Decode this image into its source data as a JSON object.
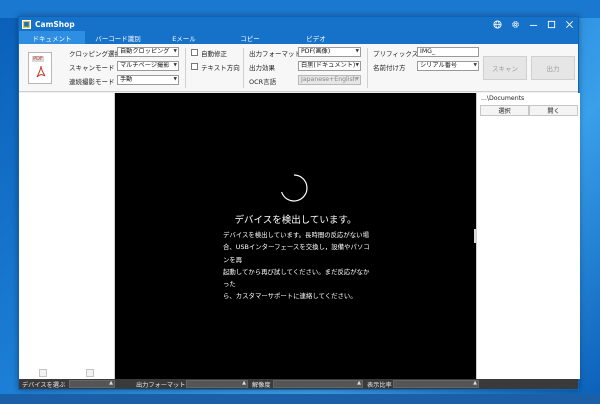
{
  "app": {
    "title": "CamShop"
  },
  "titlebar": {
    "icons": [
      "globe-icon",
      "gear-icon",
      "minimize-icon",
      "maximize-icon",
      "close-icon"
    ]
  },
  "tabs": [
    {
      "label": "ドキュメント",
      "active": true
    },
    {
      "label": "バーコード識別",
      "active": false
    },
    {
      "label": "Eメール",
      "active": false
    },
    {
      "label": "コピー",
      "active": false
    },
    {
      "label": "ビデオ",
      "active": false
    }
  ],
  "toolbar": {
    "pdf_tag": "PDF",
    "crop_label": "クロッピング選択",
    "crop_value": "自動クロッピング",
    "scan_mode_label": "スキャンモード",
    "scan_mode_value": "マルチページ撮影",
    "burst_label": "連続撮影モード",
    "burst_value": "手動",
    "auto_correct_label": "自動修正",
    "text_direction_label": "テキスト方向",
    "output_format_label": "出力フォーマット",
    "output_format_value": "PDF(画像)",
    "output_effect_label": "出力効果",
    "output_effect_value": "白黒(ドキュメント)",
    "ocr_label": "OCR言語",
    "ocr_value": "Japanese+English",
    "prefix_label": "プリフィックス",
    "prefix_value": "IMG_",
    "naming_label": "名前付け方",
    "naming_value": "シリアル番号",
    "scan_button": "スキャン",
    "output_button": "出力"
  },
  "preview": {
    "title": "デバイスを検出しています。",
    "body_lines": [
      "デバイスを検出しています。長時間の反応がない場",
      "合、USBインターフェースを交換し，設備やパソコンを再",
      "起動してから再び試してください。まだ反応がなかった",
      "ら、カスタマーサポートに連絡してください。"
    ]
  },
  "right_panel": {
    "path": "...\\Documents",
    "select_button": "選択",
    "open_button": "開く"
  },
  "bottombar": {
    "device_label": "デバイスを選ぶ",
    "output_format_label": "出力フォーマット",
    "resolution_label": "解像度",
    "display_ratio_label": "表示比率"
  },
  "colors": {
    "titlebar": "#1671c8",
    "active_tab": "#2d8ee2",
    "preview_bg": "#000000"
  }
}
